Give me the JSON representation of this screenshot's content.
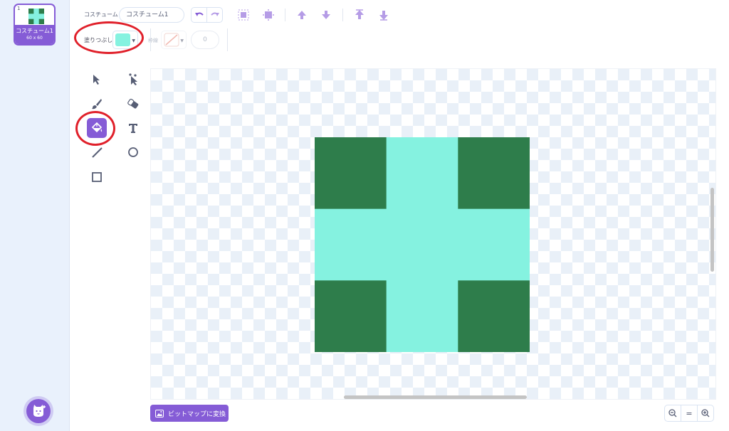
{
  "costumes": [
    {
      "index": "1",
      "name": "コスチューム1",
      "size": "60 x 60"
    }
  ],
  "toolbar": {
    "costume_label": "コスチューム",
    "costume_name": "コスチューム1",
    "fill_label": "塗りつぶし",
    "fill_color": "#85f2e0",
    "outline_label": "枠線",
    "outline_width": "0"
  },
  "art": {
    "dark_color": "#2e7d4b",
    "light_color": "#85f2e0"
  },
  "bottom": {
    "bitmap_button_label": "ビットマップに変換",
    "zoom_reset_label": "="
  },
  "accent_color": "#855cd6",
  "annotation_color": "#e0202a"
}
